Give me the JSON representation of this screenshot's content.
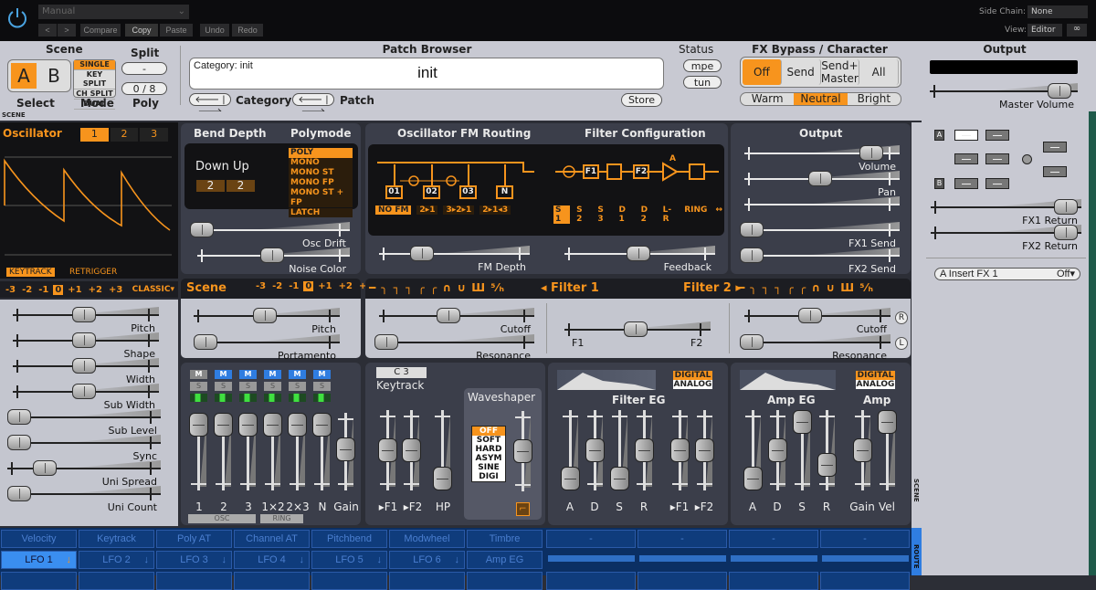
{
  "host": {
    "preset": "Manual",
    "nav_prev": "<",
    "nav_next": ">",
    "compare": "Compare",
    "copy": "Copy",
    "paste": "Paste",
    "undo": "Undo",
    "redo": "Redo",
    "side_chain_label": "Side Chain:",
    "side_chain_value": "None",
    "view_label": "View:",
    "view_value": "Editor"
  },
  "header": {
    "scene_title": "Scene",
    "scene_a": "A",
    "scene_b": "B",
    "select_label": "Select",
    "active_scene": "A",
    "modes": [
      "SINGLE",
      "KEY SPLIT",
      "CH SPLIT",
      "DUAL"
    ],
    "active_mode": "SINGLE",
    "mode_label": "Mode",
    "split_title": "Split",
    "split_value": "-",
    "poly_value": "0 / 8",
    "poly_label": "Poly",
    "patch_browser_title": "Patch Browser",
    "category_text": "Category: init",
    "patch_name": "init",
    "category_label": "Category",
    "patch_label": "Patch",
    "store": "Store",
    "status_title": "Status",
    "mpe": "mpe",
    "tun": "tun",
    "fx_title": "FX Bypass / Character",
    "fx_bypass": [
      "Off",
      "Send",
      "Send+\nMaster",
      "All"
    ],
    "fx_active": "Off",
    "character": [
      "Warm",
      "Neutral",
      "Bright"
    ],
    "character_active": "Neutral",
    "output_title": "Output",
    "master_volume_label": "Master Volume",
    "master_volume": 0.98
  },
  "scene_strip": "SCENE",
  "oscillator": {
    "title": "Oscillator",
    "tabs": [
      "1",
      "2",
      "3"
    ],
    "active_tab": "1",
    "keytrack": "KEYTRACK",
    "retrigger": "RETRIGGER",
    "octaves": [
      "-3",
      "-2",
      "-1",
      "0",
      "+1",
      "+2",
      "+3"
    ],
    "active_octave": "0",
    "type": "CLASSIC▾",
    "sliders": [
      {
        "label": "Pitch",
        "value": 0.5
      },
      {
        "label": "Shape",
        "value": 0.5
      },
      {
        "label": "Width",
        "value": 0.5
      },
      {
        "label": "Sub Width",
        "value": 0.5
      },
      {
        "label": "Sub Level",
        "value": 0
      },
      {
        "label": "Sync",
        "value": 0
      },
      {
        "label": "Uni Spread",
        "value": 0.2
      },
      {
        "label": "Uni Count",
        "value": 0
      }
    ]
  },
  "bend": {
    "title": "Bend Depth",
    "polymode_title": "Polymode",
    "down_up": "Down Up",
    "down": "2",
    "up": "2",
    "polymodes": [
      "POLY",
      "MONO",
      "MONO ST",
      "MONO FP",
      "MONO ST + FP",
      "LATCH"
    ],
    "active_polymode": "POLY",
    "osc_drift_label": "Osc Drift",
    "osc_drift": 0,
    "noise_color_label": "Noise Color",
    "noise_color": 0.5
  },
  "scene": {
    "title": "Scene",
    "octaves": [
      "-3",
      "-2",
      "-1",
      "0",
      "+1",
      "+2",
      "+3"
    ],
    "active_octave": "0",
    "pitch_label": "Pitch",
    "pitch": 0.5,
    "portamento_label": "Portamento",
    "portamento": 0
  },
  "routing": {
    "fm_title": "Oscillator FM Routing",
    "filter_title": "Filter Configuration",
    "osc_boxes": [
      "01",
      "02",
      "03",
      "N"
    ],
    "fm_modes": [
      "NO FM",
      "2▸1",
      "3▸2▸1",
      "2▸1◂3"
    ],
    "active_fm": "NO FM",
    "filter_boxes": [
      "F1",
      "F2"
    ],
    "amp_label": "A",
    "filter_modes": [
      "S 1",
      "S 2",
      "S 3",
      "D 1",
      "D 2",
      "L-R",
      "RING",
      "↔"
    ],
    "active_filter_mode": "S 1",
    "fm_depth_label": "FM Depth",
    "fm_depth": 0.25,
    "feedback_label": "Feedback",
    "feedback": 0.5
  },
  "output": {
    "title": "Output",
    "volume_label": "Volume",
    "volume": 0.9,
    "pan_label": "Pan",
    "pan": 0.5,
    "width": 0.5,
    "fx1_send_label": "FX1 Send",
    "fx1_send": 0,
    "fx2_send_label": "FX2 Send",
    "fx2_send": 0
  },
  "filters": {
    "filter1_label": "◂ Filter 1",
    "filter2_label": "Filter 2 ▸",
    "types": "━ ╮ ┐ ┐ ╭ ╭ ∩ ∪ Ш ⁵⁄ₕ",
    "cutoff_label": "Cutoff",
    "cutoff1": 0.45,
    "resonance_label": "Resonance",
    "resonance1": 0,
    "f1": "F1",
    "f2": "F2",
    "balance": 0.5,
    "cutoff2": 0.45,
    "resonance2": 0,
    "r_btn": "R",
    "l_btn": "L"
  },
  "mixer": {
    "mute": "M",
    "solo": "S",
    "channels": [
      {
        "label": "1",
        "muted": false,
        "value": 1
      },
      {
        "label": "2",
        "muted": true,
        "value": 1
      },
      {
        "label": "3",
        "muted": true,
        "value": 1
      },
      {
        "label": "1×2",
        "muted": true,
        "value": 1
      },
      {
        "label": "2×3",
        "muted": true,
        "value": 1
      },
      {
        "label": "N",
        "muted": true,
        "value": 1
      }
    ],
    "gain_label": "Gain",
    "gain": 0.55,
    "osc_group": "OSC",
    "ring_group": "RING"
  },
  "keytrack": {
    "note": "C 3",
    "title": "Keytrack",
    "f1_label": "▸F1",
    "f1": 0.5,
    "f2_label": "▸F2",
    "f2": 0.5,
    "hp_label": "HP",
    "hp": 0
  },
  "waveshaper": {
    "title": "Waveshaper",
    "types": [
      "OFF",
      "SOFT",
      "HARD",
      "ASYM",
      "SINE",
      "DIGI"
    ],
    "active": "OFF",
    "drive": 0.5
  },
  "filter_eg": {
    "title": "Filter EG",
    "digital": "DIGITAL",
    "analog": "ANALOG",
    "sliders": [
      {
        "label": "A",
        "value": 0
      },
      {
        "label": "D",
        "value": 0.5
      },
      {
        "label": "S",
        "value": 0
      },
      {
        "label": "R",
        "value": 0.5
      },
      {
        "label": "▸F1",
        "value": 0.5
      },
      {
        "label": "▸F2",
        "value": 0.5
      }
    ]
  },
  "amp_eg": {
    "title": "Amp EG",
    "amp_title": "Amp",
    "digital": "DIGITAL",
    "analog": "ANALOG",
    "sliders": [
      {
        "label": "A",
        "value": 0
      },
      {
        "label": "D",
        "value": 0.5
      },
      {
        "label": "S",
        "value": 1
      },
      {
        "label": "R",
        "value": 0.25
      },
      {
        "label": "Gain",
        "value": 0.5
      },
      {
        "label": "Vel",
        "value": 1
      }
    ]
  },
  "fx_panel": {
    "a": "A",
    "b": "B",
    "fx1_return_label": "FX1 Return",
    "fx1_return": 1,
    "fx2_return_label": "FX2 Return",
    "fx2_return": 1,
    "insert_label": "A Insert FX 1",
    "insert_value": "Off▾"
  },
  "side_tabs": {
    "scene": "SCENE",
    "route": "ROUTE"
  },
  "mod_sources": {
    "row1": [
      "Velocity",
      "Keytrack",
      "Poly AT",
      "Channel AT",
      "Pitchbend",
      "Modwheel",
      "Timbre",
      "-",
      "-",
      "-",
      "-"
    ],
    "row2": [
      "LFO 1",
      "LFO 2",
      "LFO 3",
      "LFO 4",
      "LFO 5",
      "LFO 6",
      "Amp EG"
    ],
    "active": "LFO 1",
    "arrow": "↓"
  },
  "colors": {
    "accent": "#f7941d",
    "panel": "#3b3e4a",
    "mod_bg": "#0f3c7c",
    "mute_blue": "#2f7de1"
  }
}
